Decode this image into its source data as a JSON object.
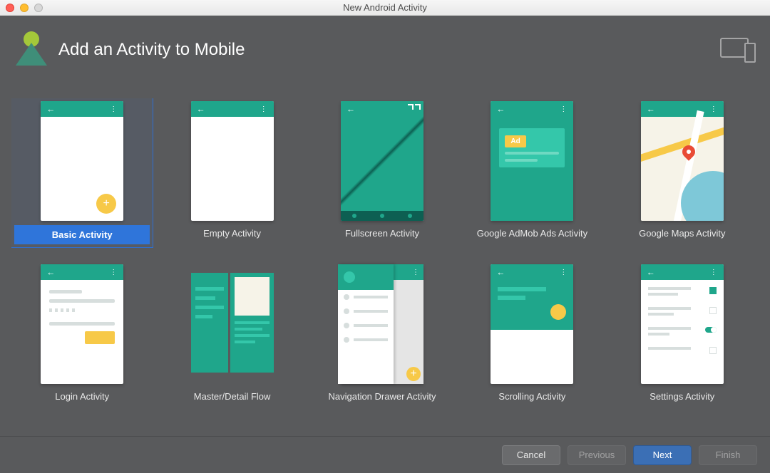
{
  "window": {
    "title": "New Android Activity"
  },
  "header": {
    "heading": "Add an Activity to Mobile"
  },
  "templates": [
    {
      "id": "basic",
      "label": "Basic Activity",
      "selected": true
    },
    {
      "id": "empty",
      "label": "Empty Activity",
      "selected": false
    },
    {
      "id": "fullscreen",
      "label": "Fullscreen Activity",
      "selected": false
    },
    {
      "id": "admob",
      "label": "Google AdMob Ads Activity",
      "selected": false
    },
    {
      "id": "gmaps",
      "label": "Google Maps Activity",
      "selected": false
    },
    {
      "id": "login",
      "label": "Login Activity",
      "selected": false
    },
    {
      "id": "masterdetail",
      "label": "Master/Detail Flow",
      "selected": false
    },
    {
      "id": "navdrawer",
      "label": "Navigation Drawer Activity",
      "selected": false
    },
    {
      "id": "scrolling",
      "label": "Scrolling Activity",
      "selected": false
    },
    {
      "id": "settings",
      "label": "Settings Activity",
      "selected": false
    }
  ],
  "admob": {
    "badge": "Ad"
  },
  "buttons": {
    "cancel": "Cancel",
    "previous": "Previous",
    "next": "Next",
    "finish": "Finish"
  }
}
